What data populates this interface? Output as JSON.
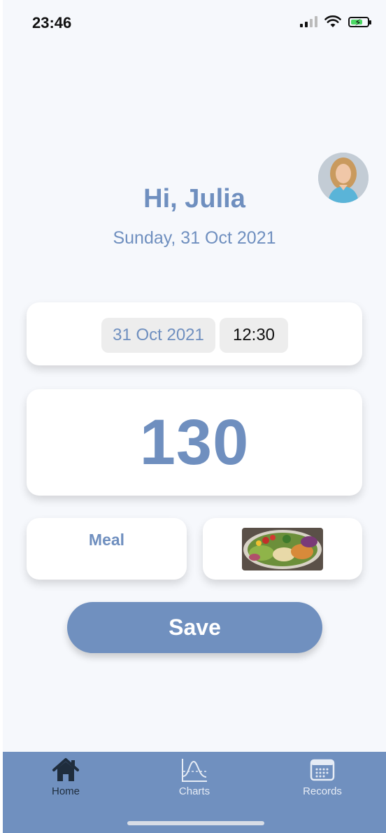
{
  "status_bar": {
    "time": "23:46"
  },
  "header": {
    "greeting": "Hi, Julia",
    "date": "Sunday, 31 Oct 2021"
  },
  "entry": {
    "date": "31 Oct 2021",
    "time": "12:30",
    "value": "130",
    "meal_label": "Meal"
  },
  "actions": {
    "save_label": "Save"
  },
  "tabs": [
    {
      "label": "Home",
      "icon": "house-icon",
      "active": true
    },
    {
      "label": "Charts",
      "icon": "chart-icon",
      "active": false
    },
    {
      "label": "Records",
      "icon": "calendar-icon",
      "active": false
    }
  ],
  "colors": {
    "accent": "#7090bf",
    "background": "#f6f8fc",
    "active_tab": "#1f2d3d"
  }
}
